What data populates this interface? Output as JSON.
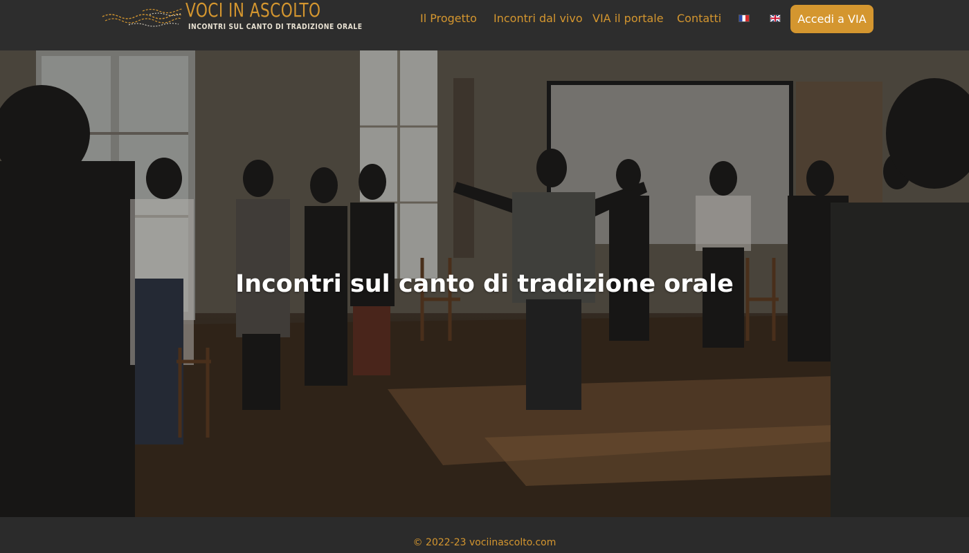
{
  "brand": {
    "title": "VOCI IN ASCOLTO",
    "subtitle": "INCONTRI SUL CANTO DI TRADIZIONE ORALE",
    "accent_color": "#d4962f"
  },
  "nav": {
    "items": [
      {
        "label": "Il Progetto"
      },
      {
        "label": "Incontri dal vivo"
      },
      {
        "label": "VIA il portale"
      },
      {
        "label": "Contatti"
      }
    ],
    "languages": [
      {
        "icon": "flag-fr-icon"
      },
      {
        "icon": "flag-en-icon"
      }
    ],
    "cta_label": "Accedi a VIA"
  },
  "hero": {
    "title": "Incontri sul canto di tradizione orale"
  },
  "footer": {
    "copyright": "© 2022-23 vociinascolto.com"
  }
}
